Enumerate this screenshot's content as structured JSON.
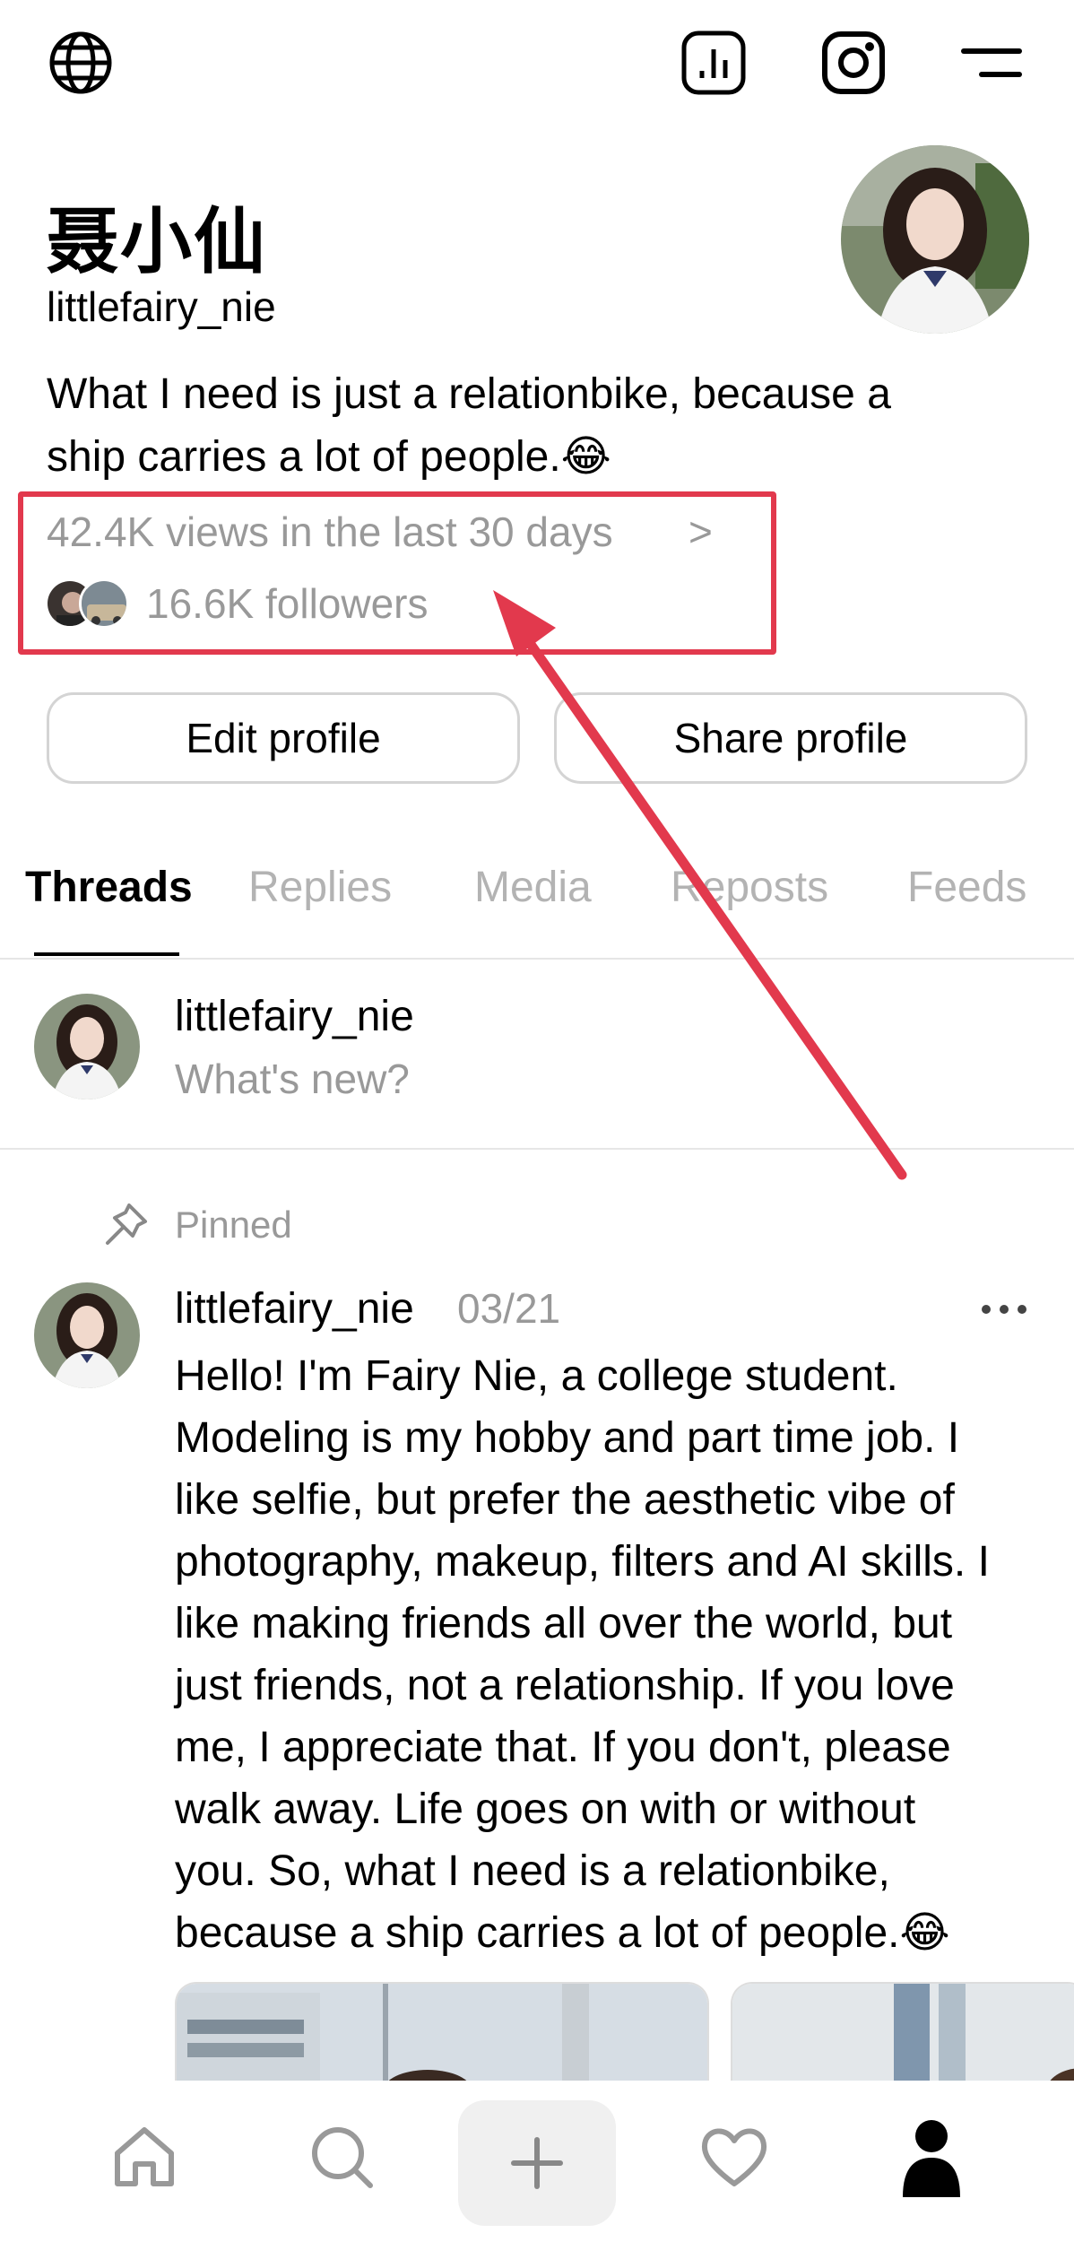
{
  "profile": {
    "name": "聂小仙",
    "handle": "littlefairy_nie",
    "bio": "What I need is just a relationbike, because a ship carries a lot of people.😂",
    "views": "42.4K views in the last 30 days",
    "views_chevron": ">",
    "followers": "16.6K followers"
  },
  "buttons": {
    "edit": "Edit profile",
    "share": "Share profile"
  },
  "tabs": [
    {
      "label": "Threads"
    },
    {
      "label": "Replies"
    },
    {
      "label": "Media"
    },
    {
      "label": "Reposts"
    },
    {
      "label": "Feeds"
    }
  ],
  "composer": {
    "name": "littlefairy_nie",
    "prompt": "What's new?"
  },
  "post": {
    "pinned_label": "Pinned",
    "author": "littlefairy_nie",
    "date": "03/21",
    "lines": [
      "Hello! I'm Fairy Nie, a college student.",
      "Modeling is my hobby and part time job. I",
      "like selfie, but prefer the aesthetic vibe of",
      "photography, makeup, filters and AI skills. I",
      "like making friends all over the world, but",
      "just friends, not a relationship. If you love",
      "me, I appreciate that. If you don't, please",
      "walk away. Life goes on with or without",
      "you. So, what I need is a relationbike,",
      "because a ship carries a lot of people.😂"
    ]
  },
  "icons": {
    "top": [
      "globe-icon",
      "insights-icon",
      "instagram-icon",
      "menu-icon"
    ],
    "nav": [
      "home-icon",
      "search-icon",
      "plus-icon",
      "heart-icon",
      "profile-icon"
    ]
  },
  "colors": {
    "annotation": "#e2394d",
    "muted_text": "#999999",
    "active_tab": "#000000",
    "inactive_tab": "#b3b3b3"
  }
}
